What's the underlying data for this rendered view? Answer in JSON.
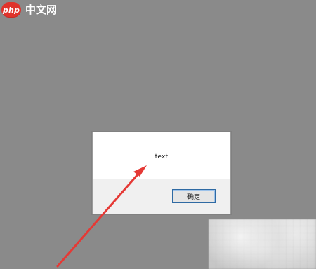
{
  "watermark": {
    "badge_text": "php",
    "site_text": "中文网",
    "brand_color": "#e0332b"
  },
  "dialog": {
    "message": "text",
    "ok_label": "确定"
  },
  "annotation": {
    "arrow_color": "#e53935",
    "icon": "arrow-icon"
  }
}
